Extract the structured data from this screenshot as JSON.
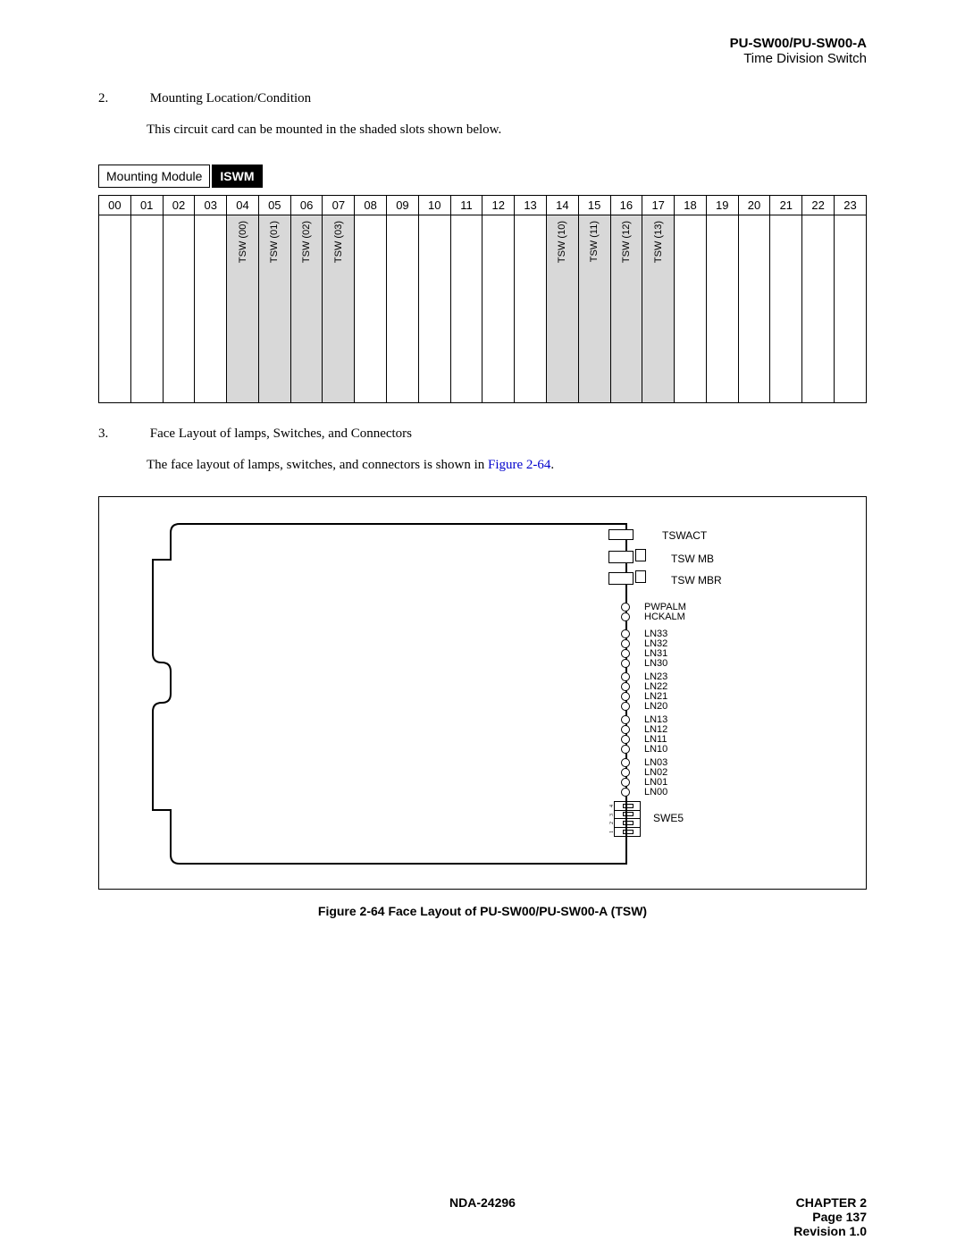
{
  "header": {
    "title": "PU-SW00/PU-SW00-A",
    "subtitle": "Time Division Switch"
  },
  "section2": {
    "num": "2.",
    "title": "Mounting Location/Condition",
    "para": "This circuit card can be mounted in the shaded slots shown below."
  },
  "module": {
    "label": "Mounting Module",
    "name": "ISWM"
  },
  "slots": {
    "headers": [
      "00",
      "01",
      "02",
      "03",
      "04",
      "05",
      "06",
      "07",
      "08",
      "09",
      "10",
      "11",
      "12",
      "13",
      "14",
      "15",
      "16",
      "17",
      "18",
      "19",
      "20",
      "21",
      "22",
      "23"
    ],
    "cells": {
      "4": "TSW (00)",
      "5": "TSW (01)",
      "6": "TSW (02)",
      "7": "TSW (03)",
      "14": "TSW (10)",
      "15": "TSW (11)",
      "16": "TSW (12)",
      "17": "TSW (13)"
    }
  },
  "section3": {
    "num": "3.",
    "title": "Face Layout of lamps, Switches, and Connectors",
    "para_pre": "The face layout of lamps, switches, and connectors is shown in ",
    "link": "Figure 2-64",
    "para_post": "."
  },
  "face": {
    "tswact": "TSWACT",
    "tswmb": "TSW MB",
    "tswmbr": "TSW MBR",
    "alm1": "PWPALM",
    "alm2": "HCKALM",
    "ln_groups": [
      [
        "LN33",
        "LN32",
        "LN31",
        "LN30"
      ],
      [
        "LN23",
        "LN22",
        "LN21",
        "LN20"
      ],
      [
        "LN13",
        "LN12",
        "LN11",
        "LN10"
      ],
      [
        "LN03",
        "LN02",
        "LN01",
        "LN00"
      ]
    ],
    "swe5": "SWE5",
    "sw_nums": [
      "4",
      "3",
      "2",
      "1"
    ]
  },
  "caption": "Figure 2-64   Face Layout of PU-SW00/PU-SW00-A (TSW)",
  "footer": {
    "doc": "NDA-24296",
    "chapter": "CHAPTER 2",
    "page": "Page 137",
    "rev": "Revision 1.0"
  }
}
